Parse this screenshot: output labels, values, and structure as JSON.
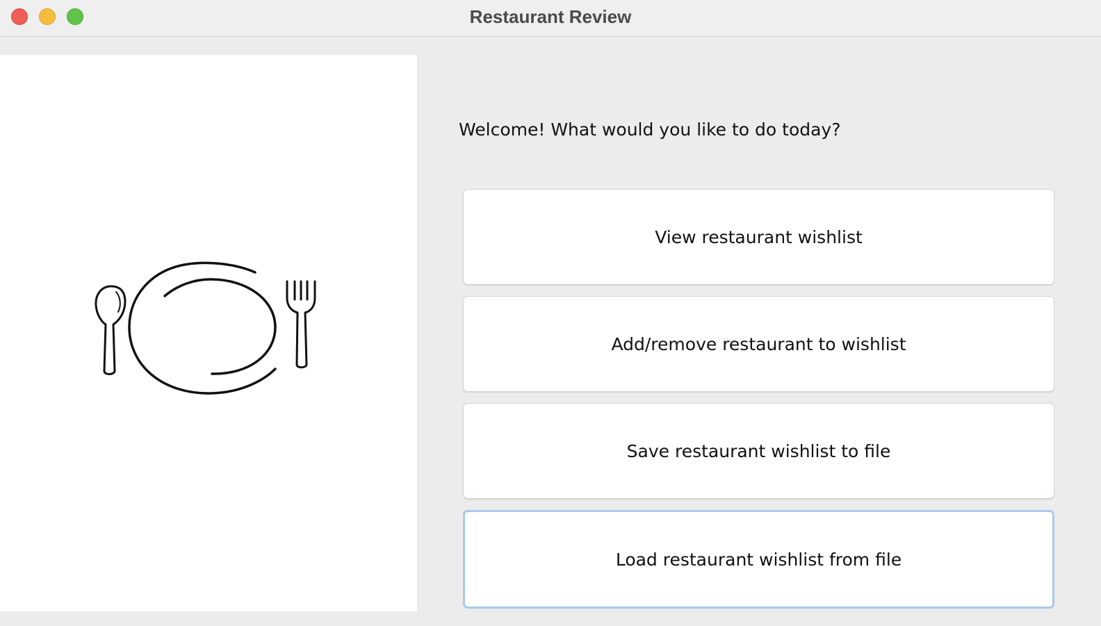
{
  "window": {
    "title": "Restaurant Review",
    "controls": [
      "close",
      "minimize",
      "maximize"
    ]
  },
  "illustration": {
    "icon": "plate-with-spoon-and-fork-icon"
  },
  "main": {
    "welcome_text": "Welcome! What would you like to do today?",
    "buttons": [
      {
        "label": "View restaurant wishlist"
      },
      {
        "label": "Add/remove restaurant to wishlist"
      },
      {
        "label": "Save restaurant wishlist to file"
      },
      {
        "label": "Load restaurant wishlist from file",
        "focused": true
      }
    ]
  },
  "colors": {
    "close": "#ee5f57",
    "minimize": "#f6bd3b",
    "maximize": "#5ec44a",
    "focus_ring": "#a9c9ef"
  }
}
